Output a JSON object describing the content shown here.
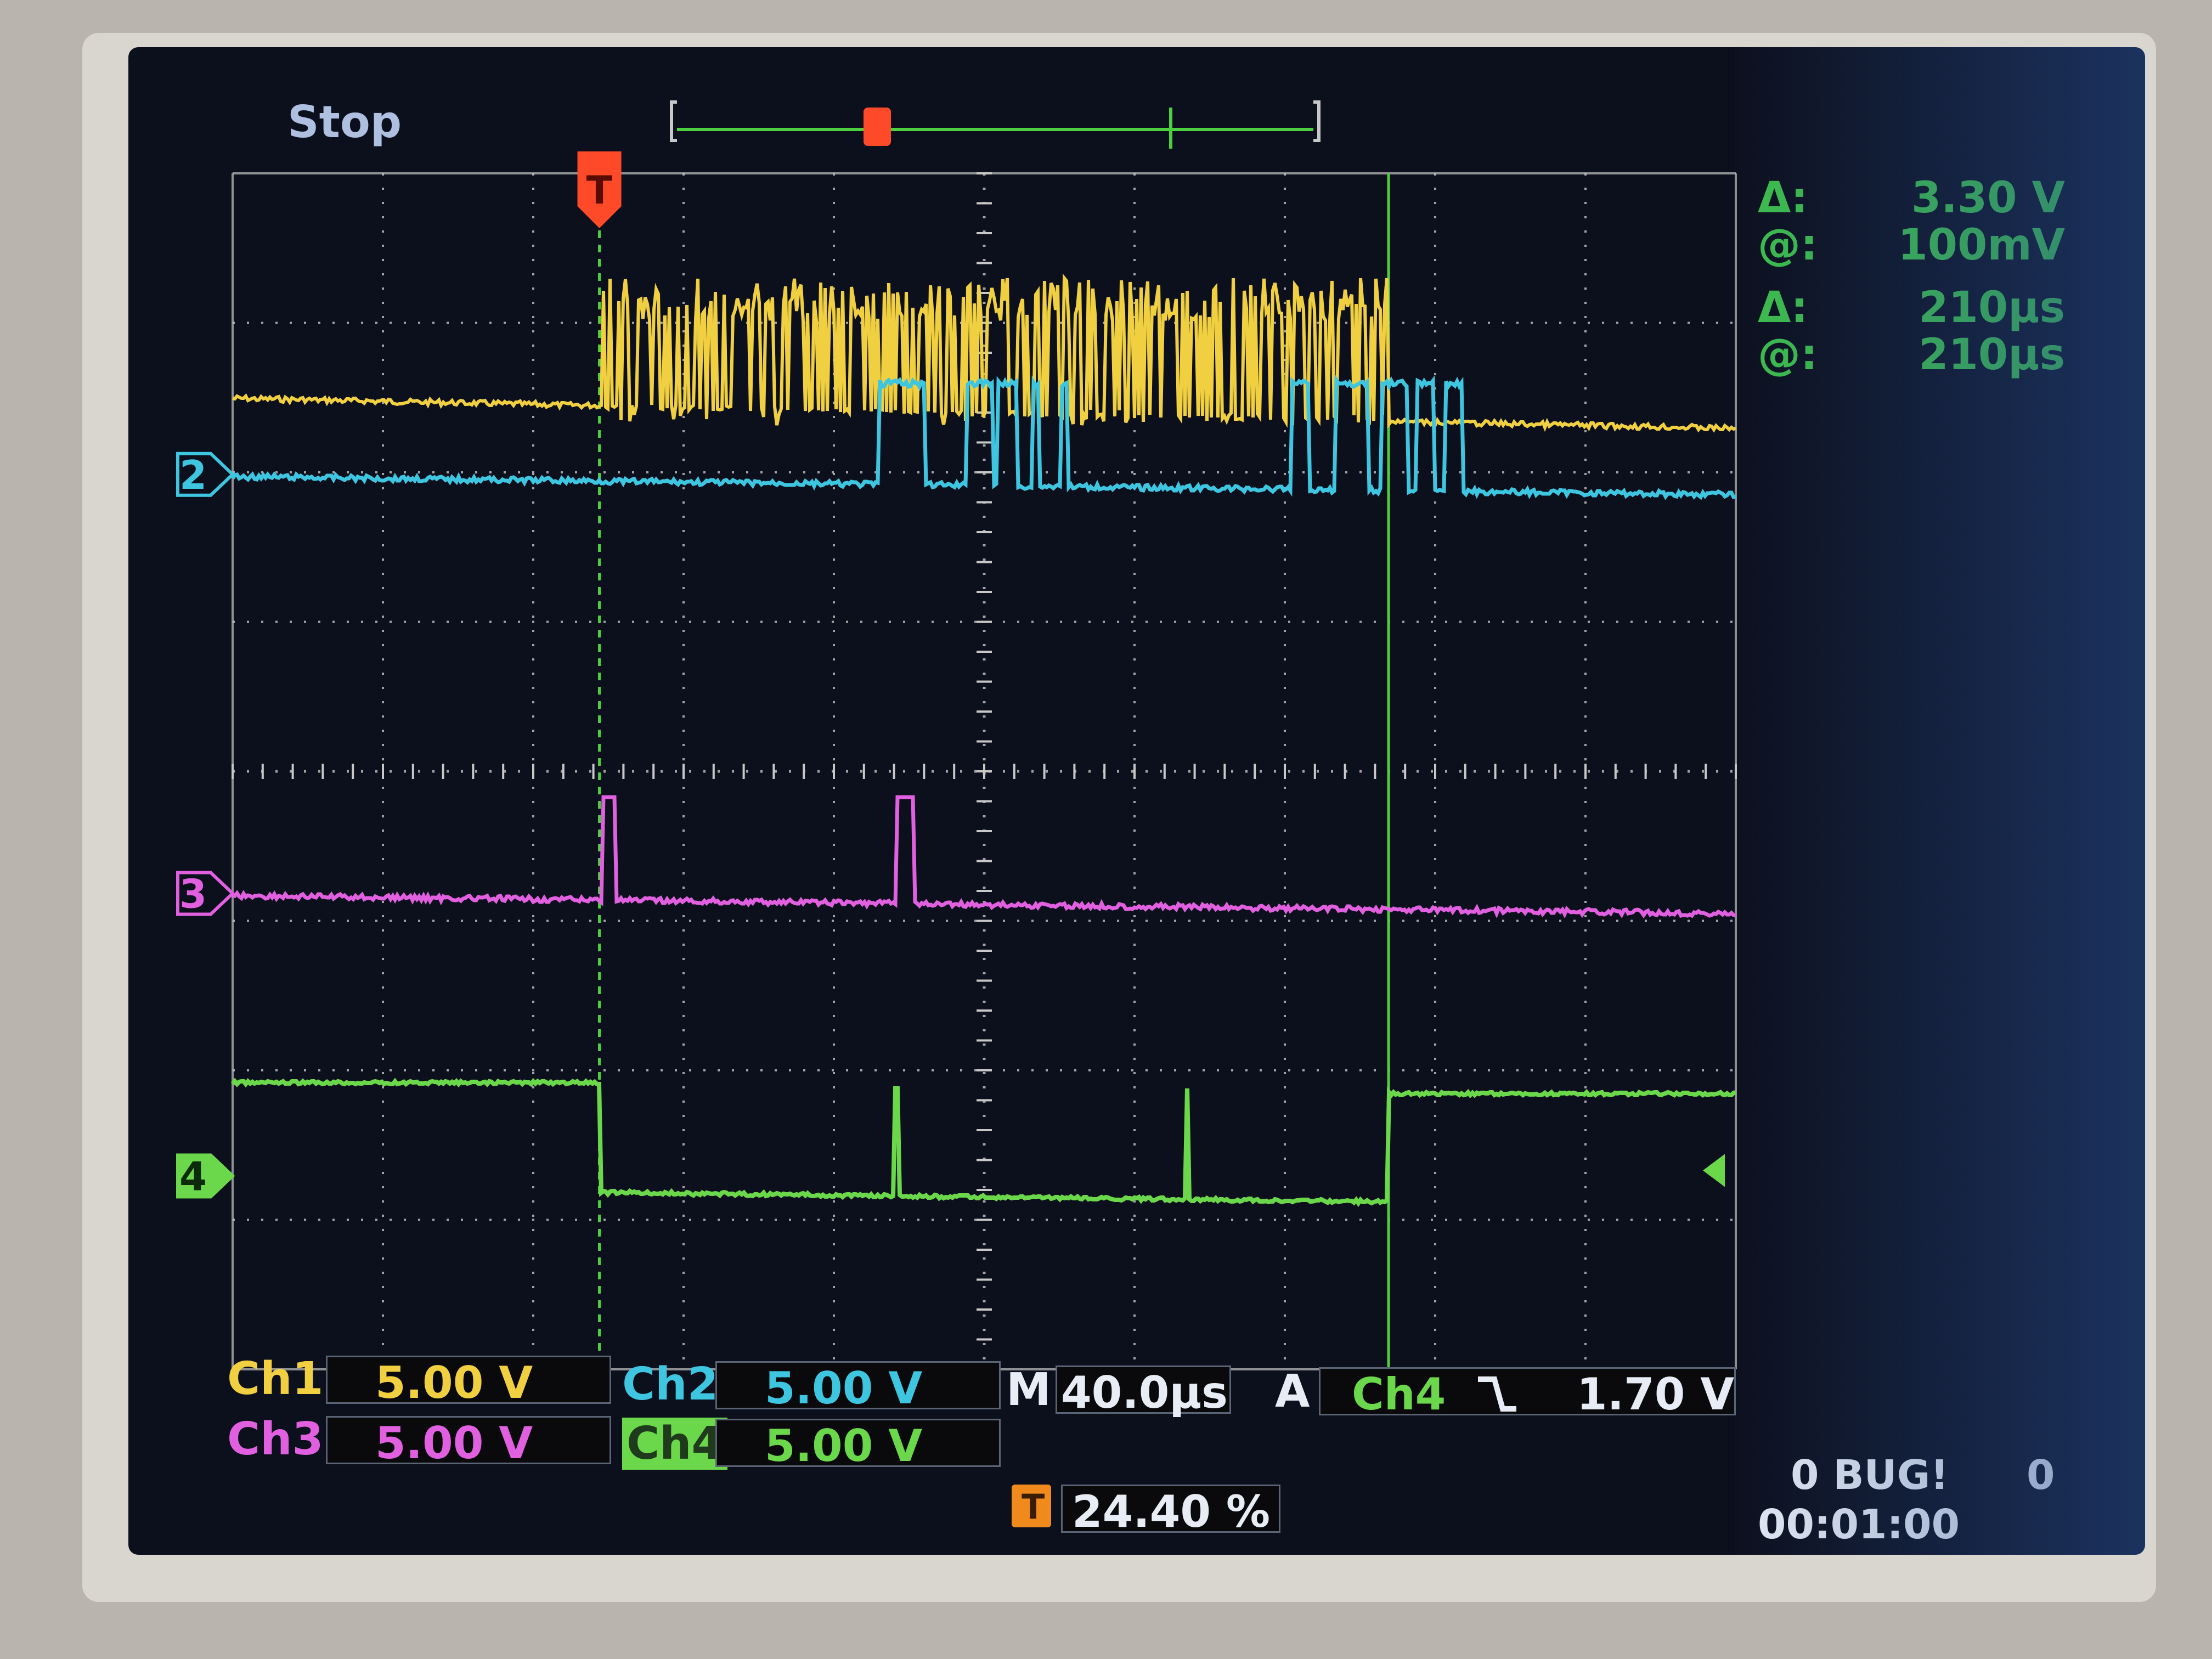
{
  "status": "Stop",
  "readouts": [
    {
      "symbol": "Δ:",
      "value": "3.30 V"
    },
    {
      "symbol": "@:",
      "value": "100mV"
    },
    {
      "symbol": "Δ:",
      "value": "210µs"
    },
    {
      "symbol": "@:",
      "value": "210µs"
    }
  ],
  "channel_markers": [
    {
      "label": "2",
      "color": "#3ec5e0"
    },
    {
      "label": "3",
      "color": "#e060e0"
    },
    {
      "label": "4",
      "color": "#6ad84a"
    }
  ],
  "trigger_marker": {
    "label": "T",
    "color": "#ff4a2a"
  },
  "channels": [
    {
      "name": "Ch1",
      "scale": "5.00 V",
      "color": "#f0d040"
    },
    {
      "name": "Ch2",
      "scale": "5.00 V",
      "color": "#3ec5e0"
    },
    {
      "name": "Ch3",
      "scale": "5.00 V",
      "color": "#e060e0"
    },
    {
      "name": "Ch4",
      "scale": "5.00 V",
      "color": "#6ad84a"
    }
  ],
  "timebase": {
    "label": "M",
    "value": "40.0µs"
  },
  "trigger": {
    "label": "A",
    "source": "Ch4",
    "slope": "falling",
    "level": "1.70 V"
  },
  "trigger_position": {
    "label": "T",
    "value": "24.40 %"
  },
  "counter": {
    "left": "0 BUG!",
    "right": "0",
    "time": "00:01:00"
  },
  "colors": {
    "ch1": "#f0d040",
    "ch2": "#3ec5e0",
    "ch3": "#e060e0",
    "ch4": "#6ad84a",
    "grid": "#c8c8c8",
    "trigger": "#ff4a2a",
    "cursor": "#4cd040",
    "readout": "#3ec04a"
  }
}
